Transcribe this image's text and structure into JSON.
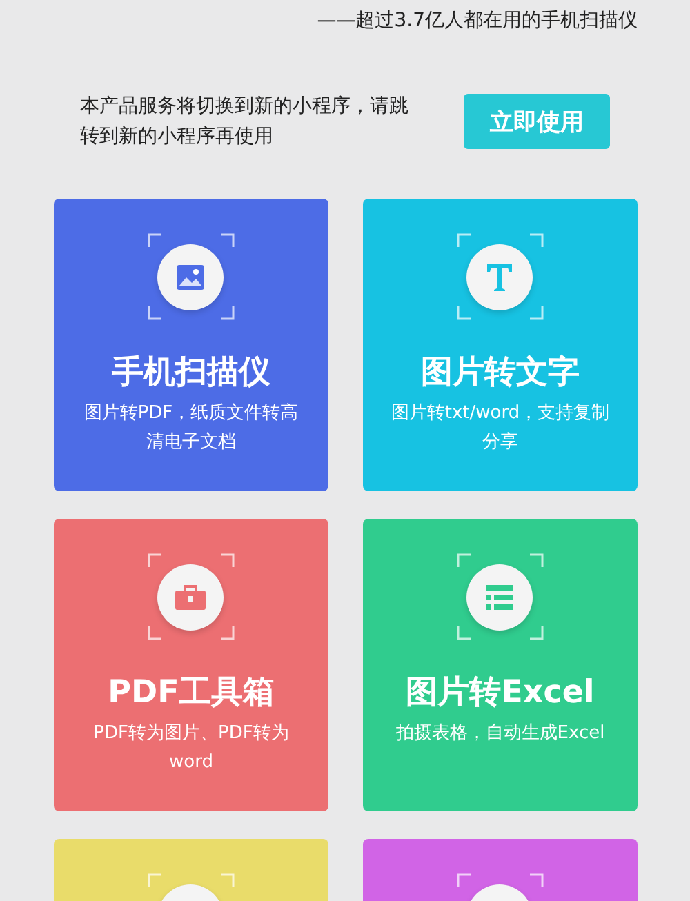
{
  "tagline": "——超过3.7亿人都在用的手机扫描仪",
  "notice": {
    "text": "本产品服务将切换到新的小程序，请跳转到新的小程序再使用",
    "button": "立即使用"
  },
  "cards": [
    {
      "kind": "image",
      "color": "#4d6ce6",
      "title": "手机扫描仪",
      "description": "图片转PDF，纸质文件转高清电子文档"
    },
    {
      "kind": "text",
      "color": "#17c2e2",
      "title": "图片转文字",
      "description": "图片转txt/word，支持复制分享"
    },
    {
      "kind": "toolbox",
      "color": "#ec6f72",
      "title": "PDF工具箱",
      "description": "PDF转为图片、PDF转为word"
    },
    {
      "kind": "table",
      "color": "#30cc8e",
      "title": "图片转Excel",
      "description": "拍摄表格，自动生成Excel"
    },
    {
      "kind": "partial",
      "color": "#e9dc6a"
    },
    {
      "kind": "partial",
      "color": "#d164e6"
    }
  ]
}
